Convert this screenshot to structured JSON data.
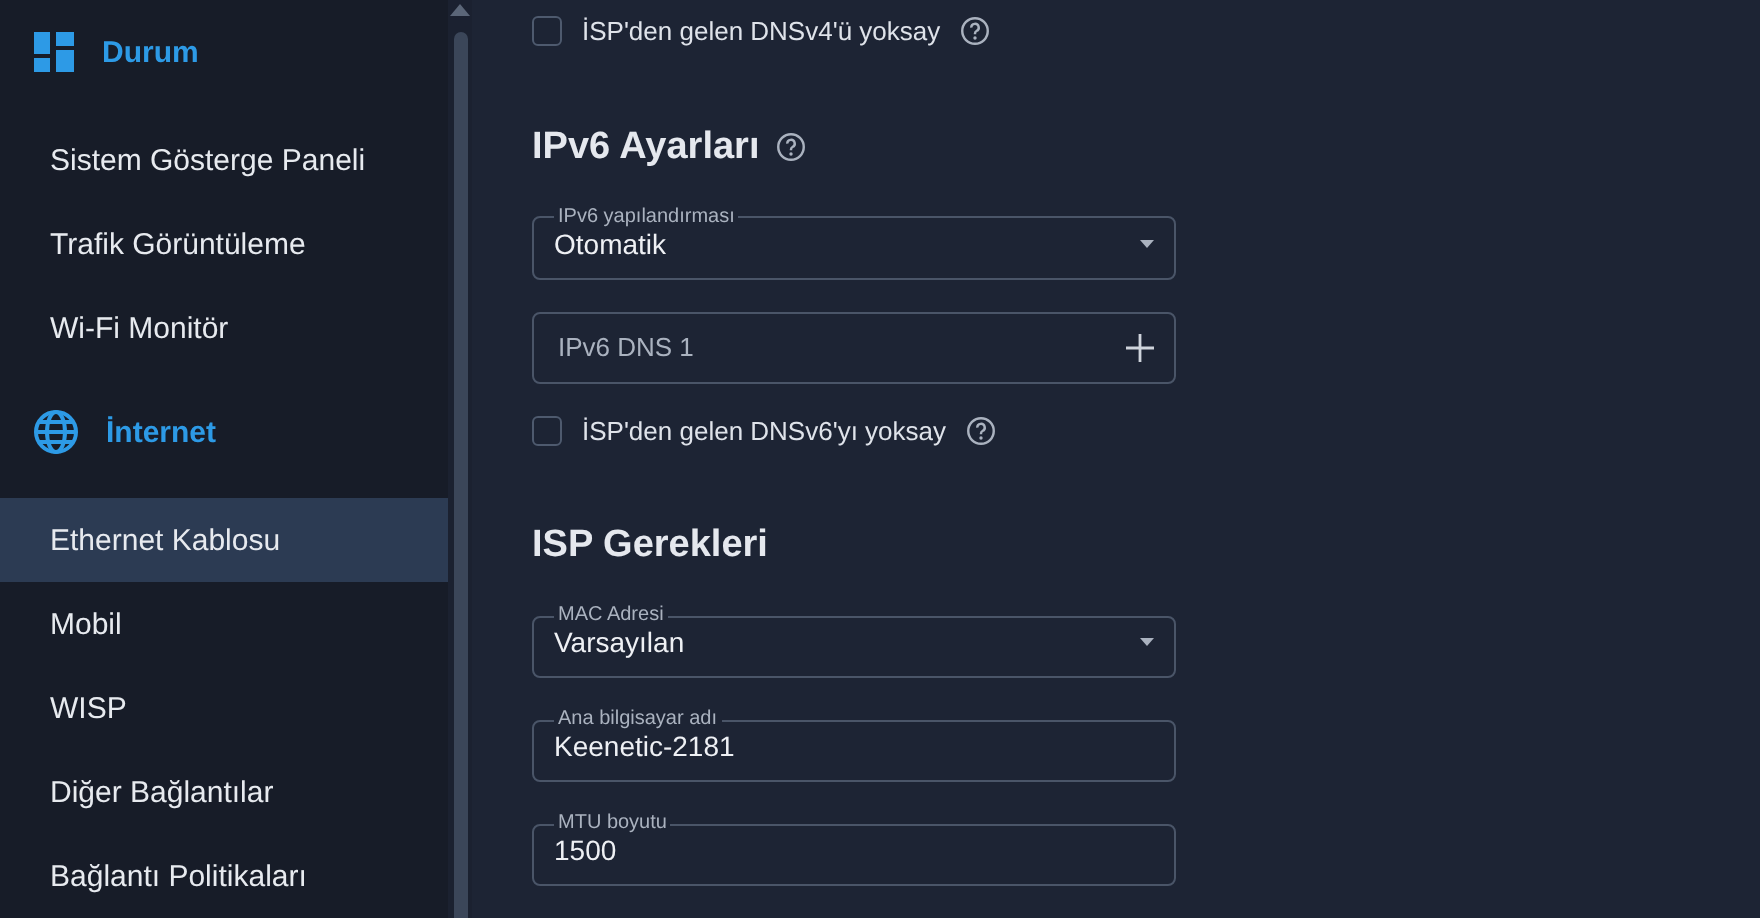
{
  "sidebar": {
    "sections": [
      {
        "title": "Durum",
        "items": [
          {
            "label": "Sistem Gösterge Paneli",
            "selected": false
          },
          {
            "label": "Trafik Görüntüleme",
            "selected": false
          },
          {
            "label": "Wi-Fi Monitör",
            "selected": false
          }
        ]
      },
      {
        "title": "İnternet",
        "items": [
          {
            "label": "Ethernet Kablosu",
            "selected": true
          },
          {
            "label": "Mobil",
            "selected": false
          },
          {
            "label": "WISP",
            "selected": false
          },
          {
            "label": "Diğer Bağlantılar",
            "selected": false
          },
          {
            "label": "Bağlantı Politikaları",
            "selected": false
          }
        ]
      }
    ]
  },
  "content": [
    {
      "kind": "checkbox",
      "label": "İSP'den gelen DNSv4'ü yoksay",
      "checked": false,
      "help": true
    },
    {
      "kind": "heading",
      "text": "IPv6 Ayarları",
      "help": true
    },
    {
      "kind": "select",
      "label": "IPv6 yapılandırması",
      "value": "Otomatik"
    },
    {
      "kind": "add",
      "placeholder": "IPv6 DNS 1"
    },
    {
      "kind": "checkbox",
      "label": "İSP'den gelen DNSv6'yı yoksay",
      "checked": false,
      "help": true
    },
    {
      "kind": "heading",
      "text": "ISP Gerekleri",
      "help": false
    },
    {
      "kind": "select",
      "label": "MAC Adresi",
      "value": "Varsayılan"
    },
    {
      "kind": "text",
      "label": "Ana bilgisayar adı",
      "value": "Keenetic-2181"
    },
    {
      "kind": "text",
      "label": "MTU boyutu",
      "value": "1500"
    }
  ]
}
